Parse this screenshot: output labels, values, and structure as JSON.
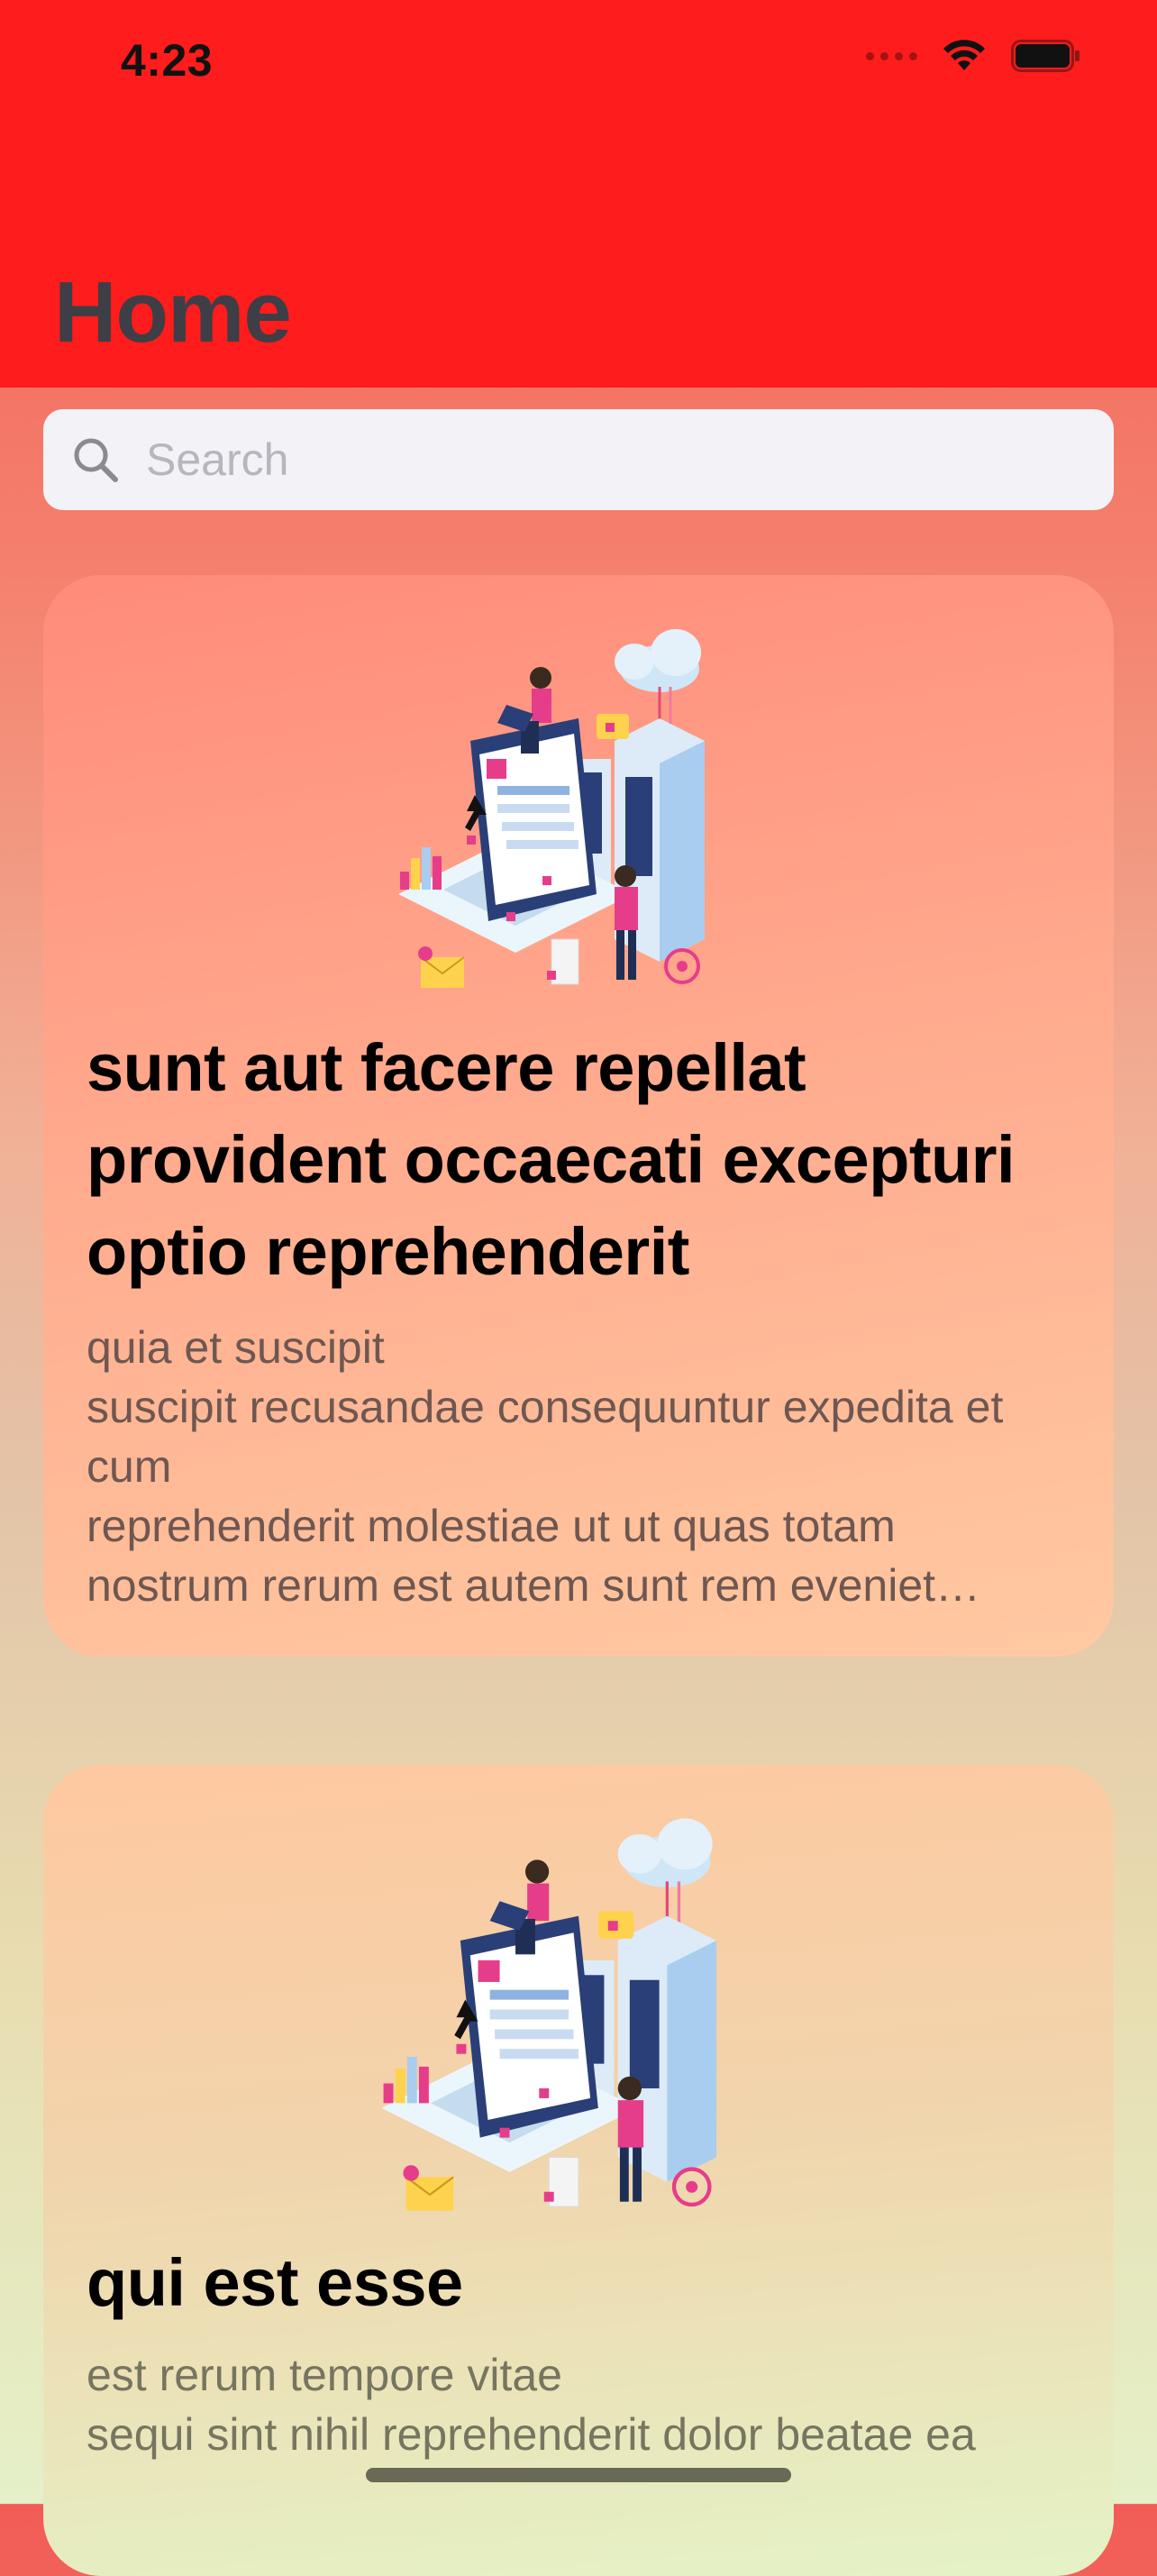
{
  "status_bar": {
    "time": "4:23",
    "icons": [
      "signal-icon",
      "wifi-icon",
      "battery-icon"
    ]
  },
  "header": {
    "title": "Home",
    "background": "#ff1c1c"
  },
  "search": {
    "placeholder": "Search",
    "icon": "search-icon"
  },
  "posts": [
    {
      "title": "sunt aut facere repellat provident occaecati excepturi optio reprehenderit",
      "body": "quia et suscipit\nsuscipit recusandae consequuntur expedita et cum\nreprehenderit molestiae ut ut quas totam\nnostrum rerum est autem sunt rem eveniet architecto",
      "image": "server-network-illustration"
    },
    {
      "title": "qui est esse",
      "body": "est rerum tempore vitae\nsequi sint nihil reprehenderit dolor beatae ea",
      "image": "server-network-illustration"
    }
  ],
  "colors": {
    "accent": "#ff1c1c",
    "title_text": "#3e3e46",
    "search_background": "#f3f2f7"
  }
}
